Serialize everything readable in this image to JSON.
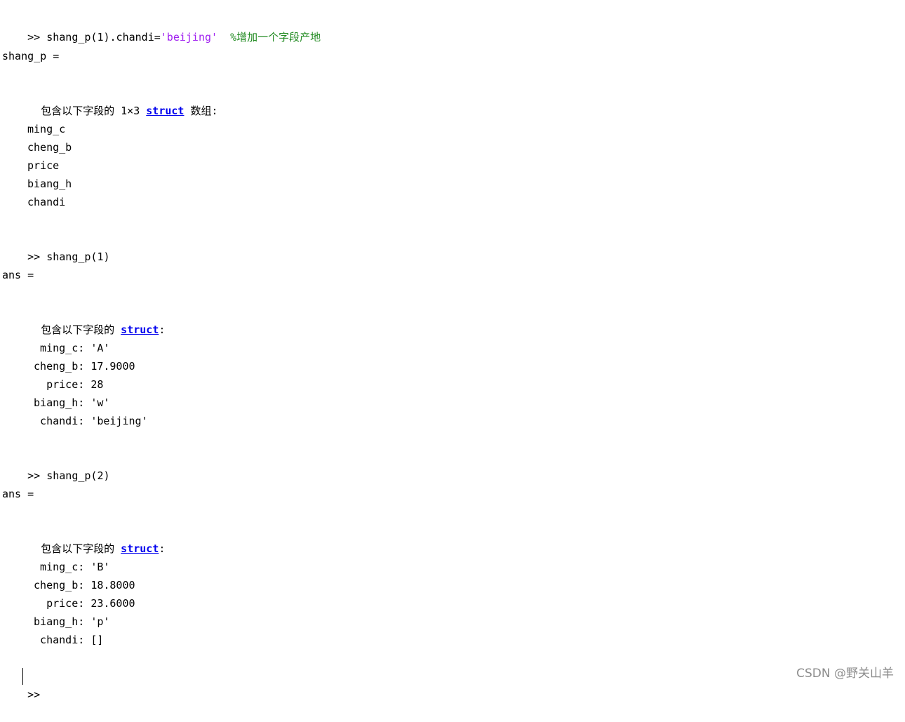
{
  "console": {
    "prompt": ">>",
    "cmd1": {
      "code_before_str": " shang_p(1).chandi=",
      "string_literal": "'beijing'",
      "comment": "  %增加一个字段产地"
    },
    "out1": {
      "var_assign": "shang_p =",
      "desc_prefix": "包含以下字段的 1×3 ",
      "desc_link": "struct",
      "desc_suffix": " 数组:",
      "fields": [
        "ming_c",
        "cheng_b",
        "price",
        "biang_h",
        "chandi"
      ]
    },
    "cmd2": " shang_p(1)",
    "out2": {
      "var_assign": "ans =",
      "desc_prefix": "包含以下字段的 ",
      "desc_link": "struct",
      "desc_suffix": ":",
      "rows": [
        {
          "name": "  ming_c",
          "value": "'A'"
        },
        {
          "name": " cheng_b",
          "value": "17.9000"
        },
        {
          "name": "   price",
          "value": "28"
        },
        {
          "name": " biang_h",
          "value": "'w'"
        },
        {
          "name": "  chandi",
          "value": "'beijing'"
        }
      ]
    },
    "cmd3": " shang_p(2)",
    "out3": {
      "var_assign": "ans =",
      "desc_prefix": "包含以下字段的 ",
      "desc_link": "struct",
      "desc_suffix": ":",
      "rows": [
        {
          "name": "  ming_c",
          "value": "'B'"
        },
        {
          "name": " cheng_b",
          "value": "18.8000"
        },
        {
          "name": "   price",
          "value": "23.6000"
        },
        {
          "name": " biang_h",
          "value": "'p'"
        },
        {
          "name": "  chandi",
          "value": "[]"
        }
      ]
    }
  },
  "watermark": "CSDN @野关山羊",
  "colors": {
    "string": "#a020f0",
    "comment": "#228b22",
    "link": "#0000ee"
  }
}
